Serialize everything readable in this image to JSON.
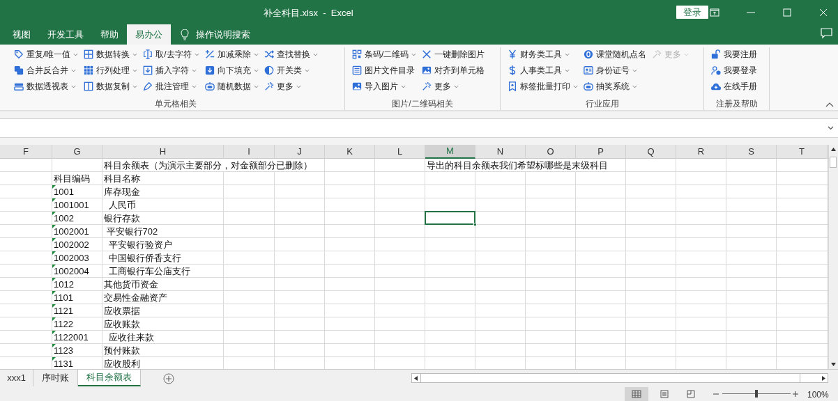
{
  "window": {
    "title": "补全科目.xlsx  -  Excel",
    "login_button": "登录"
  },
  "tabs": [
    {
      "label": "视图",
      "selected": false
    },
    {
      "label": "开发工具",
      "selected": false
    },
    {
      "label": "帮助",
      "selected": false
    },
    {
      "label": "易办公",
      "selected": true
    }
  ],
  "tell_me": {
    "placeholder": "操作说明搜索"
  },
  "ribbon": {
    "groups": [
      {
        "label": "单元格相关",
        "columns": [
          [
            {
              "label": "重复/唯一值",
              "dropdown": true,
              "disabled": false
            },
            {
              "label": "合并反合并",
              "dropdown": true,
              "disabled": false
            },
            {
              "label": "数据透视表",
              "dropdown": true,
              "disabled": false
            }
          ],
          [
            {
              "label": "数据转换",
              "dropdown": true,
              "disabled": false
            },
            {
              "label": "行列处理",
              "dropdown": true,
              "disabled": false
            },
            {
              "label": "数据复制",
              "dropdown": true,
              "disabled": false
            }
          ],
          [
            {
              "label": "取/去字符",
              "dropdown": true,
              "disabled": false
            },
            {
              "label": "插入字符",
              "dropdown": true,
              "disabled": false
            },
            {
              "label": "批注管理",
              "dropdown": true,
              "disabled": false
            }
          ],
          [
            {
              "label": "加减乘除",
              "dropdown": true,
              "disabled": false
            },
            {
              "label": "向下填充",
              "dropdown": true,
              "disabled": false
            },
            {
              "label": "随机数据",
              "dropdown": true,
              "disabled": false
            }
          ],
          [
            {
              "label": "查找替换",
              "dropdown": true,
              "disabled": false
            },
            {
              "label": "开关类",
              "dropdown": true,
              "disabled": false
            },
            {
              "label": "更多",
              "dropdown": true,
              "disabled": false
            }
          ]
        ]
      },
      {
        "label": "图片/二维码相关",
        "columns": [
          [
            {
              "label": "条码/二维码",
              "dropdown": true,
              "disabled": false
            },
            {
              "label": "图片文件目录",
              "dropdown": false,
              "disabled": false
            },
            {
              "label": "导入图片",
              "dropdown": true,
              "disabled": false
            }
          ],
          [
            {
              "label": "一键删除图片",
              "dropdown": false,
              "disabled": false
            },
            {
              "label": "对齐到单元格",
              "dropdown": false,
              "disabled": false
            },
            {
              "label": "更多",
              "dropdown": true,
              "disabled": false
            }
          ]
        ]
      },
      {
        "label": "行业应用",
        "columns": [
          [
            {
              "label": "财务类工具",
              "dropdown": true,
              "disabled": false
            },
            {
              "label": "人事类工具",
              "dropdown": true,
              "disabled": false
            },
            {
              "label": "标签批量打印",
              "dropdown": true,
              "disabled": false
            }
          ],
          [
            {
              "label": "课堂随机点名",
              "dropdown": false,
              "disabled": false
            },
            {
              "label": "身份证号",
              "dropdown": true,
              "disabled": false
            },
            {
              "label": "抽奖系统",
              "dropdown": true,
              "disabled": false
            }
          ],
          [
            {
              "label": "更多",
              "dropdown": true,
              "disabled": true
            }
          ]
        ]
      },
      {
        "label": "注册及帮助",
        "columns": [
          [
            {
              "label": "我要注册",
              "dropdown": false,
              "disabled": false
            },
            {
              "label": "我要登录",
              "dropdown": false,
              "disabled": false
            },
            {
              "label": "在线手册",
              "dropdown": false,
              "disabled": false
            }
          ]
        ]
      }
    ]
  },
  "sheet": {
    "columns": [
      {
        "label": "F",
        "selected": false
      },
      {
        "label": "G",
        "selected": false
      },
      {
        "label": "H",
        "selected": false
      },
      {
        "label": "I",
        "selected": false
      },
      {
        "label": "J",
        "selected": false
      },
      {
        "label": "K",
        "selected": false
      },
      {
        "label": "L",
        "selected": false
      },
      {
        "label": "M",
        "selected": true
      },
      {
        "label": "N",
        "selected": false
      },
      {
        "label": "O",
        "selected": false
      },
      {
        "label": "P",
        "selected": false
      },
      {
        "label": "Q",
        "selected": false
      },
      {
        "label": "R",
        "selected": false
      },
      {
        "label": "S",
        "selected": false
      },
      {
        "label": "T",
        "selected": false
      }
    ],
    "rows": [
      {
        "selected": false,
        "number_stored_as_text": false,
        "cells": {
          "H": "科目余额表（为演示主要部分，对金额部分已删除）",
          "M": "导出的科目余额表我们希望标哪些是末级科目"
        }
      },
      {
        "selected": false,
        "number_stored_as_text": false,
        "cells": {
          "G": "科目编码",
          "H": "科目名称"
        }
      },
      {
        "selected": false,
        "number_stored_as_text": true,
        "cells": {
          "G": "1001",
          "H": "库存现金"
        }
      },
      {
        "selected": false,
        "number_stored_as_text": true,
        "cells": {
          "G": "1001001",
          "H": "  人民币"
        }
      },
      {
        "selected": true,
        "number_stored_as_text": true,
        "cells": {
          "G": "1002",
          "H": "银行存款"
        }
      },
      {
        "selected": false,
        "number_stored_as_text": true,
        "cells": {
          "G": "1002001",
          "H": " 平安银行702"
        }
      },
      {
        "selected": false,
        "number_stored_as_text": true,
        "cells": {
          "G": "1002002",
          "H": "  平安银行验资户"
        }
      },
      {
        "selected": false,
        "number_stored_as_text": true,
        "cells": {
          "G": "1002003",
          "H": "  中国银行侨香支行"
        }
      },
      {
        "selected": false,
        "number_stored_as_text": true,
        "cells": {
          "G": "1002004",
          "H": "  工商银行车公庙支行"
        }
      },
      {
        "selected": false,
        "number_stored_as_text": true,
        "cells": {
          "G": "1012",
          "H": "其他货币资金"
        }
      },
      {
        "selected": false,
        "number_stored_as_text": true,
        "cells": {
          "G": "1101",
          "H": "交易性金融资产"
        }
      },
      {
        "selected": false,
        "number_stored_as_text": true,
        "cells": {
          "G": "1121",
          "H": "应收票据"
        }
      },
      {
        "selected": false,
        "number_stored_as_text": true,
        "cells": {
          "G": "1122",
          "H": "应收账款"
        }
      },
      {
        "selected": false,
        "number_stored_as_text": true,
        "cells": {
          "G": "1122001",
          "H": "  应收往来款"
        }
      },
      {
        "selected": false,
        "number_stored_as_text": true,
        "cells": {
          "G": "1123",
          "H": "预付账款"
        }
      },
      {
        "selected": false,
        "number_stored_as_text": true,
        "cells": {
          "G": "1131",
          "H": "应收股利"
        }
      }
    ]
  },
  "sheet_tabs": [
    {
      "label": "xxx1",
      "selected": false
    },
    {
      "label": "序时账",
      "selected": false
    },
    {
      "label": "科目余额表",
      "selected": true
    }
  ],
  "status_bar": {
    "views": [
      {
        "selected": true
      },
      {
        "selected": false
      },
      {
        "selected": false
      }
    ],
    "zoom": {
      "level": 0.5,
      "reading": "100%"
    }
  }
}
